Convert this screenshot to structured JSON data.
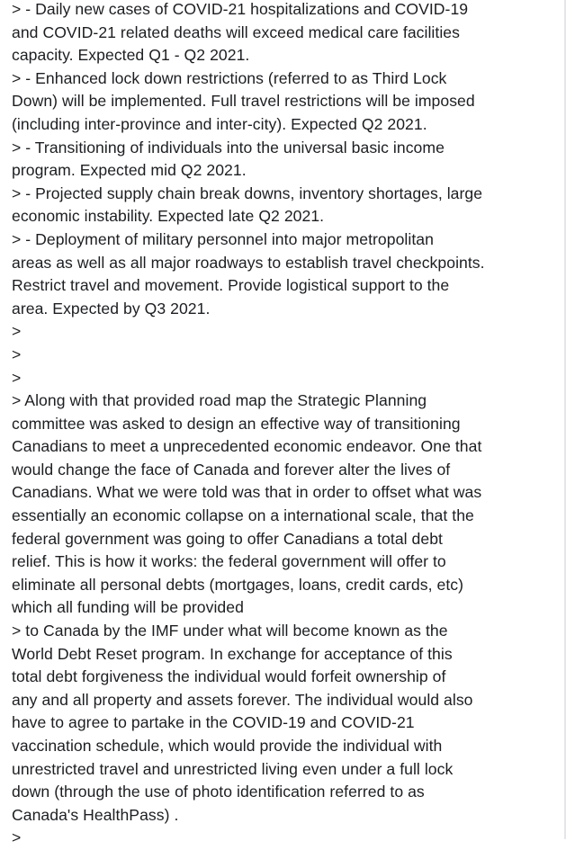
{
  "post": {
    "lines": [
      "> - Daily new cases of COVID-21 hospitalizations and COVID-19",
      "and COVID-21 related deaths will exceed medical care facilities",
      "capacity. Expected Q1 - Q2 2021.",
      "> - Enhanced lock down restrictions (referred to as Third Lock",
      "Down) will be implemented. Full travel restrictions will be imposed",
      "(including inter-province and inter-city). Expected Q2 2021.",
      "> - Transitioning of individuals into the universal basic income",
      "program. Expected mid Q2 2021.",
      "> - Projected supply chain break downs, inventory shortages, large",
      "economic instability. Expected late Q2 2021.",
      "> - Deployment of military personnel into major metropolitan",
      "areas as well as all major roadways to establish travel checkpoints.",
      "Restrict travel and movement. Provide logistical support to the",
      "area. Expected by Q3 2021.",
      ">",
      ">",
      ">",
      "> Along with that provided road map the Strategic Planning",
      "committee was asked to design an effective way of transitioning",
      "Canadians to meet a unprecedented economic endeavor. One that",
      "would change the face of Canada and forever alter the lives of",
      "Canadians. What we were told was that in order to offset what was",
      "essentially an economic collapse on a international scale, that the",
      "federal government was going to offer Canadians a total debt",
      "relief. This is how it works: the federal government will offer to",
      "eliminate all personal debts (mortgages, loans, credit cards, etc)",
      "which all funding will be provided",
      "> to Canada by the IMF under what will become known as the",
      "World Debt Reset program. In exchange for acceptance of this",
      "total debt forgiveness the individual would forfeit ownership of",
      "any and all property and assets forever. The individual would also",
      "have to agree to partake in the COVID-19 and COVID-21",
      "vaccination schedule, which would provide the individual with",
      "unrestricted travel and unrestricted living even under a full lock",
      "down (through the use of photo identification referred to as",
      "Canada's HealthPass) .",
      ">"
    ]
  }
}
